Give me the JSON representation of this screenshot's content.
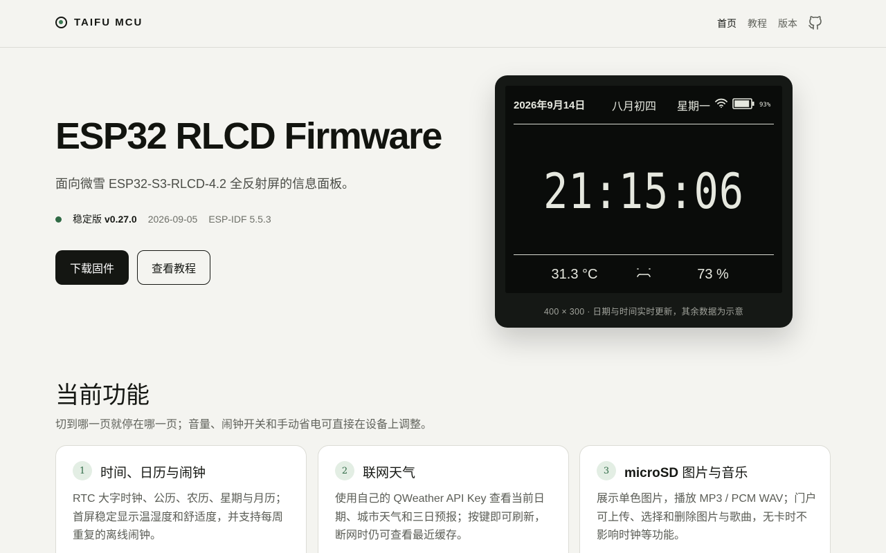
{
  "header": {
    "brand": "TAIFU MCU",
    "nav": [
      "首页",
      "教程",
      "版本"
    ],
    "github_icon": "github-icon"
  },
  "hero": {
    "title": "ESP32 RLCD Firmware",
    "subtitle": "面向微雪 ESP32-S3-RLCD-4.2 全反射屏的信息面板。",
    "channel": "稳定版",
    "version": "v0.27.0",
    "date": "2026-09-05",
    "idf": "ESP-IDF 5.5.3",
    "download_label": "下载固件",
    "tutorial_label": "查看教程"
  },
  "device": {
    "date": "2026年9月14日",
    "lunar": "八月初四",
    "weekday": "星期一",
    "battery": "93%",
    "battery_level": 0.93,
    "time": "21:15:06",
    "temperature": "31.3 °C",
    "humidity": "73 %",
    "comfort_icon": "face-icon",
    "caption": "400 × 300 · 日期与时间实时更新，其余数据为示意"
  },
  "features": {
    "title": "当前功能",
    "subtitle": "切到哪一页就停在哪一页；音量、闹钟开关和手动省电可直接在设备上调整。",
    "cards": [
      {
        "num": "1",
        "title": "时间、日历与闹钟",
        "body": "RTC 大字时钟、公历、农历、星期与月历；首屏稳定显示温湿度和舒适度，并支持每周重复的离线闹钟。"
      },
      {
        "num": "2",
        "title": "联网天气",
        "body": "使用自己的 QWeather API Key 查看当前日期、城市天气和三日预报；按键即可刷新，断网时仍可查看最近缓存。"
      },
      {
        "num": "3",
        "title_bold": "microSD",
        "title": " 图片与音乐",
        "body": "展示单色图片，播放 MP3 / PCM WAV；门户可上传、选择和删除图片与歌曲，无卡时不影响时钟等功能。"
      }
    ]
  }
}
